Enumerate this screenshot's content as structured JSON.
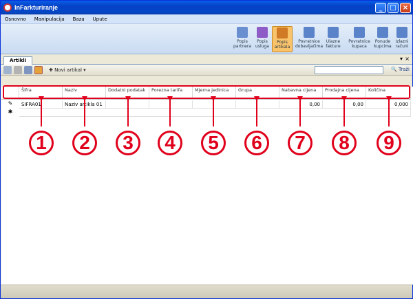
{
  "window": {
    "title": "InFarkturiranje"
  },
  "menu": [
    "Osnovno",
    "Manipulacija",
    "Baza",
    "Upute"
  ],
  "ribbon": [
    {
      "label": "Popis partnera",
      "color": "#6a8fd1"
    },
    {
      "label": "Popis usluga",
      "color": "#8e5cc6"
    },
    {
      "label": "Popis artikala",
      "color": "#d07a26",
      "active": true
    },
    {
      "label": "Povratnice dobavljačima",
      "color": "#5a83c9"
    },
    {
      "label": "Ulazne fakture",
      "color": "#5a83c9"
    },
    {
      "label": "Povratnice kupaca",
      "color": "#5a83c9"
    },
    {
      "label": "Ponude kupcima",
      "color": "#5a83c9"
    },
    {
      "label": "Izlazni računi",
      "color": "#5a83c9"
    }
  ],
  "tab": {
    "label": "Artikli"
  },
  "toolbar": {
    "new_item": "Novi artikal",
    "search": "Traži"
  },
  "grid": {
    "headers": [
      "Šifra",
      "Naziv",
      "Dodatni podatak",
      "Porezna tarifa",
      "Mjerna jedinica",
      "Grupa",
      "Nabavna cijena",
      "Prodajna cijena",
      "Količina"
    ],
    "row": [
      "SIFRA01",
      "Naziv artikla 01",
      "",
      "",
      "",
      "",
      "0,00",
      "0,00",
      "0,000"
    ]
  },
  "annotations": [
    "1",
    "2",
    "3",
    "4",
    "5",
    "6",
    "7",
    "8",
    "9"
  ],
  "colors": {
    "highlight": "#e0001b"
  }
}
